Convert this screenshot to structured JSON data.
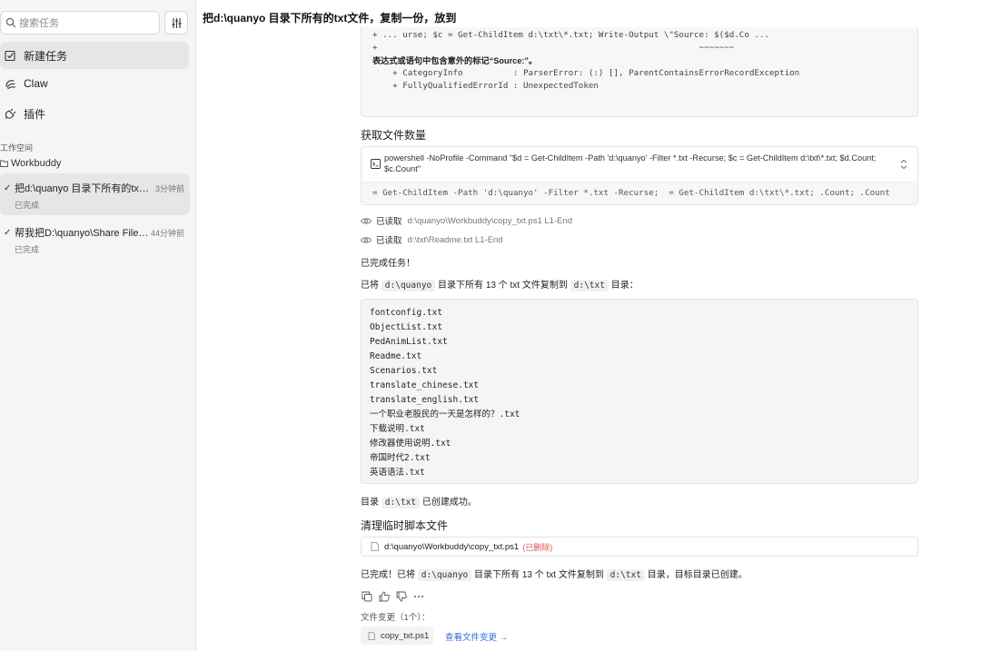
{
  "sidebar": {
    "search_placeholder": "搜索任务",
    "nav": [
      {
        "label": "新建任务",
        "icon": "edit-square-icon"
      },
      {
        "label": "Claw",
        "icon": "claw-icon"
      },
      {
        "label": "插件",
        "icon": "plug-icon"
      }
    ],
    "workspace_title": "工作空间",
    "workspace_name": "Workbuddy",
    "tasks": [
      {
        "title": "把d:\\quanyo 目录下所有的txt文件，复制一份，放到",
        "time": "3分钟前",
        "status": "已完成"
      },
      {
        "title": "帮我把D:\\quanyo\\Share Files\\...",
        "time": "44分钟前",
        "status": "已完成"
      }
    ]
  },
  "header": {
    "title": "把d:\\quanyo 目录下所有的txt文件，复制一份，放到"
  },
  "main": {
    "code_fragment": {
      "line1": "+ ... urse; $c = Get-ChildItem d:\\txt\\*.txt; Write-Output \\\"Source: $($d.Co ...",
      "line2": "+                                                                ~~~~~~~",
      "error_msg": "表达式或语句中包含意外的标记“Source:”。",
      "line3": "    + CategoryInfo          : ParserError: (:) [], ParentContainsErrorRecordException",
      "line4": "    + FullyQualifiedErrorId : UnexpectedToken"
    },
    "section_count": "获取文件数量",
    "command": {
      "text": "powershell -NoProfile -Command \"$d = Get-ChildItem -Path 'd:\\quanyo' -Filter *.txt -Recurse; $c = Get-ChildItem d:\\txt\\*.txt; $d.Count; $c.Count\"",
      "output": "= Get-ChildItem -Path 'd:\\quanyo' -Filter *.txt -Recurse;  = Get-ChildItem d:\\txt\\*.txt; .Count; .Count"
    },
    "reads": [
      {
        "label": "已读取",
        "path": "d:\\quanyo\\Workbuddy\\copy_txt.ps1  L1-End"
      },
      {
        "label": "已读取",
        "path": "d:\\txt\\Readme.txt  L1-End"
      }
    ],
    "done_line": "已完成任务！",
    "summary": {
      "prefix": "已将",
      "src": "d:\\quanyo",
      "middle": "目录下所有 13 个 txt 文件复制到",
      "dst": "d:\\txt",
      "suffix": "目录："
    },
    "files": [
      "fontconfig.txt",
      "ObjectList.txt",
      "PedAnimList.txt",
      "Readme.txt",
      "Scenarios.txt",
      "translate_chinese.txt",
      "translate_english.txt",
      "一个职业老股民的一天是怎样的？.txt",
      "下载说明.txt",
      "修改器使用说明.txt",
      "帝国时代2.txt",
      "英语语法.txt"
    ],
    "created": {
      "prefix": "目录",
      "dir": "d:\\txt",
      "suffix": "已创建成功。"
    },
    "section_cleanup": "清理临时脚本文件",
    "script": {
      "path": "d:\\quanyo\\Workbuddy\\copy_txt.ps1",
      "tag": "(已删除)"
    },
    "final": {
      "prefix": "已完成！已将",
      "src": "d:\\quanyo",
      "middle": "目录下所有 13 个 txt 文件复制到",
      "dst": "d:\\txt",
      "suffix": "目录，目标目录已创建。"
    },
    "file_changes_label": "文件变更（1个）：",
    "file_changes_chip": "copy_txt.ps1",
    "file_changes_link": "查看文件变更 →"
  }
}
